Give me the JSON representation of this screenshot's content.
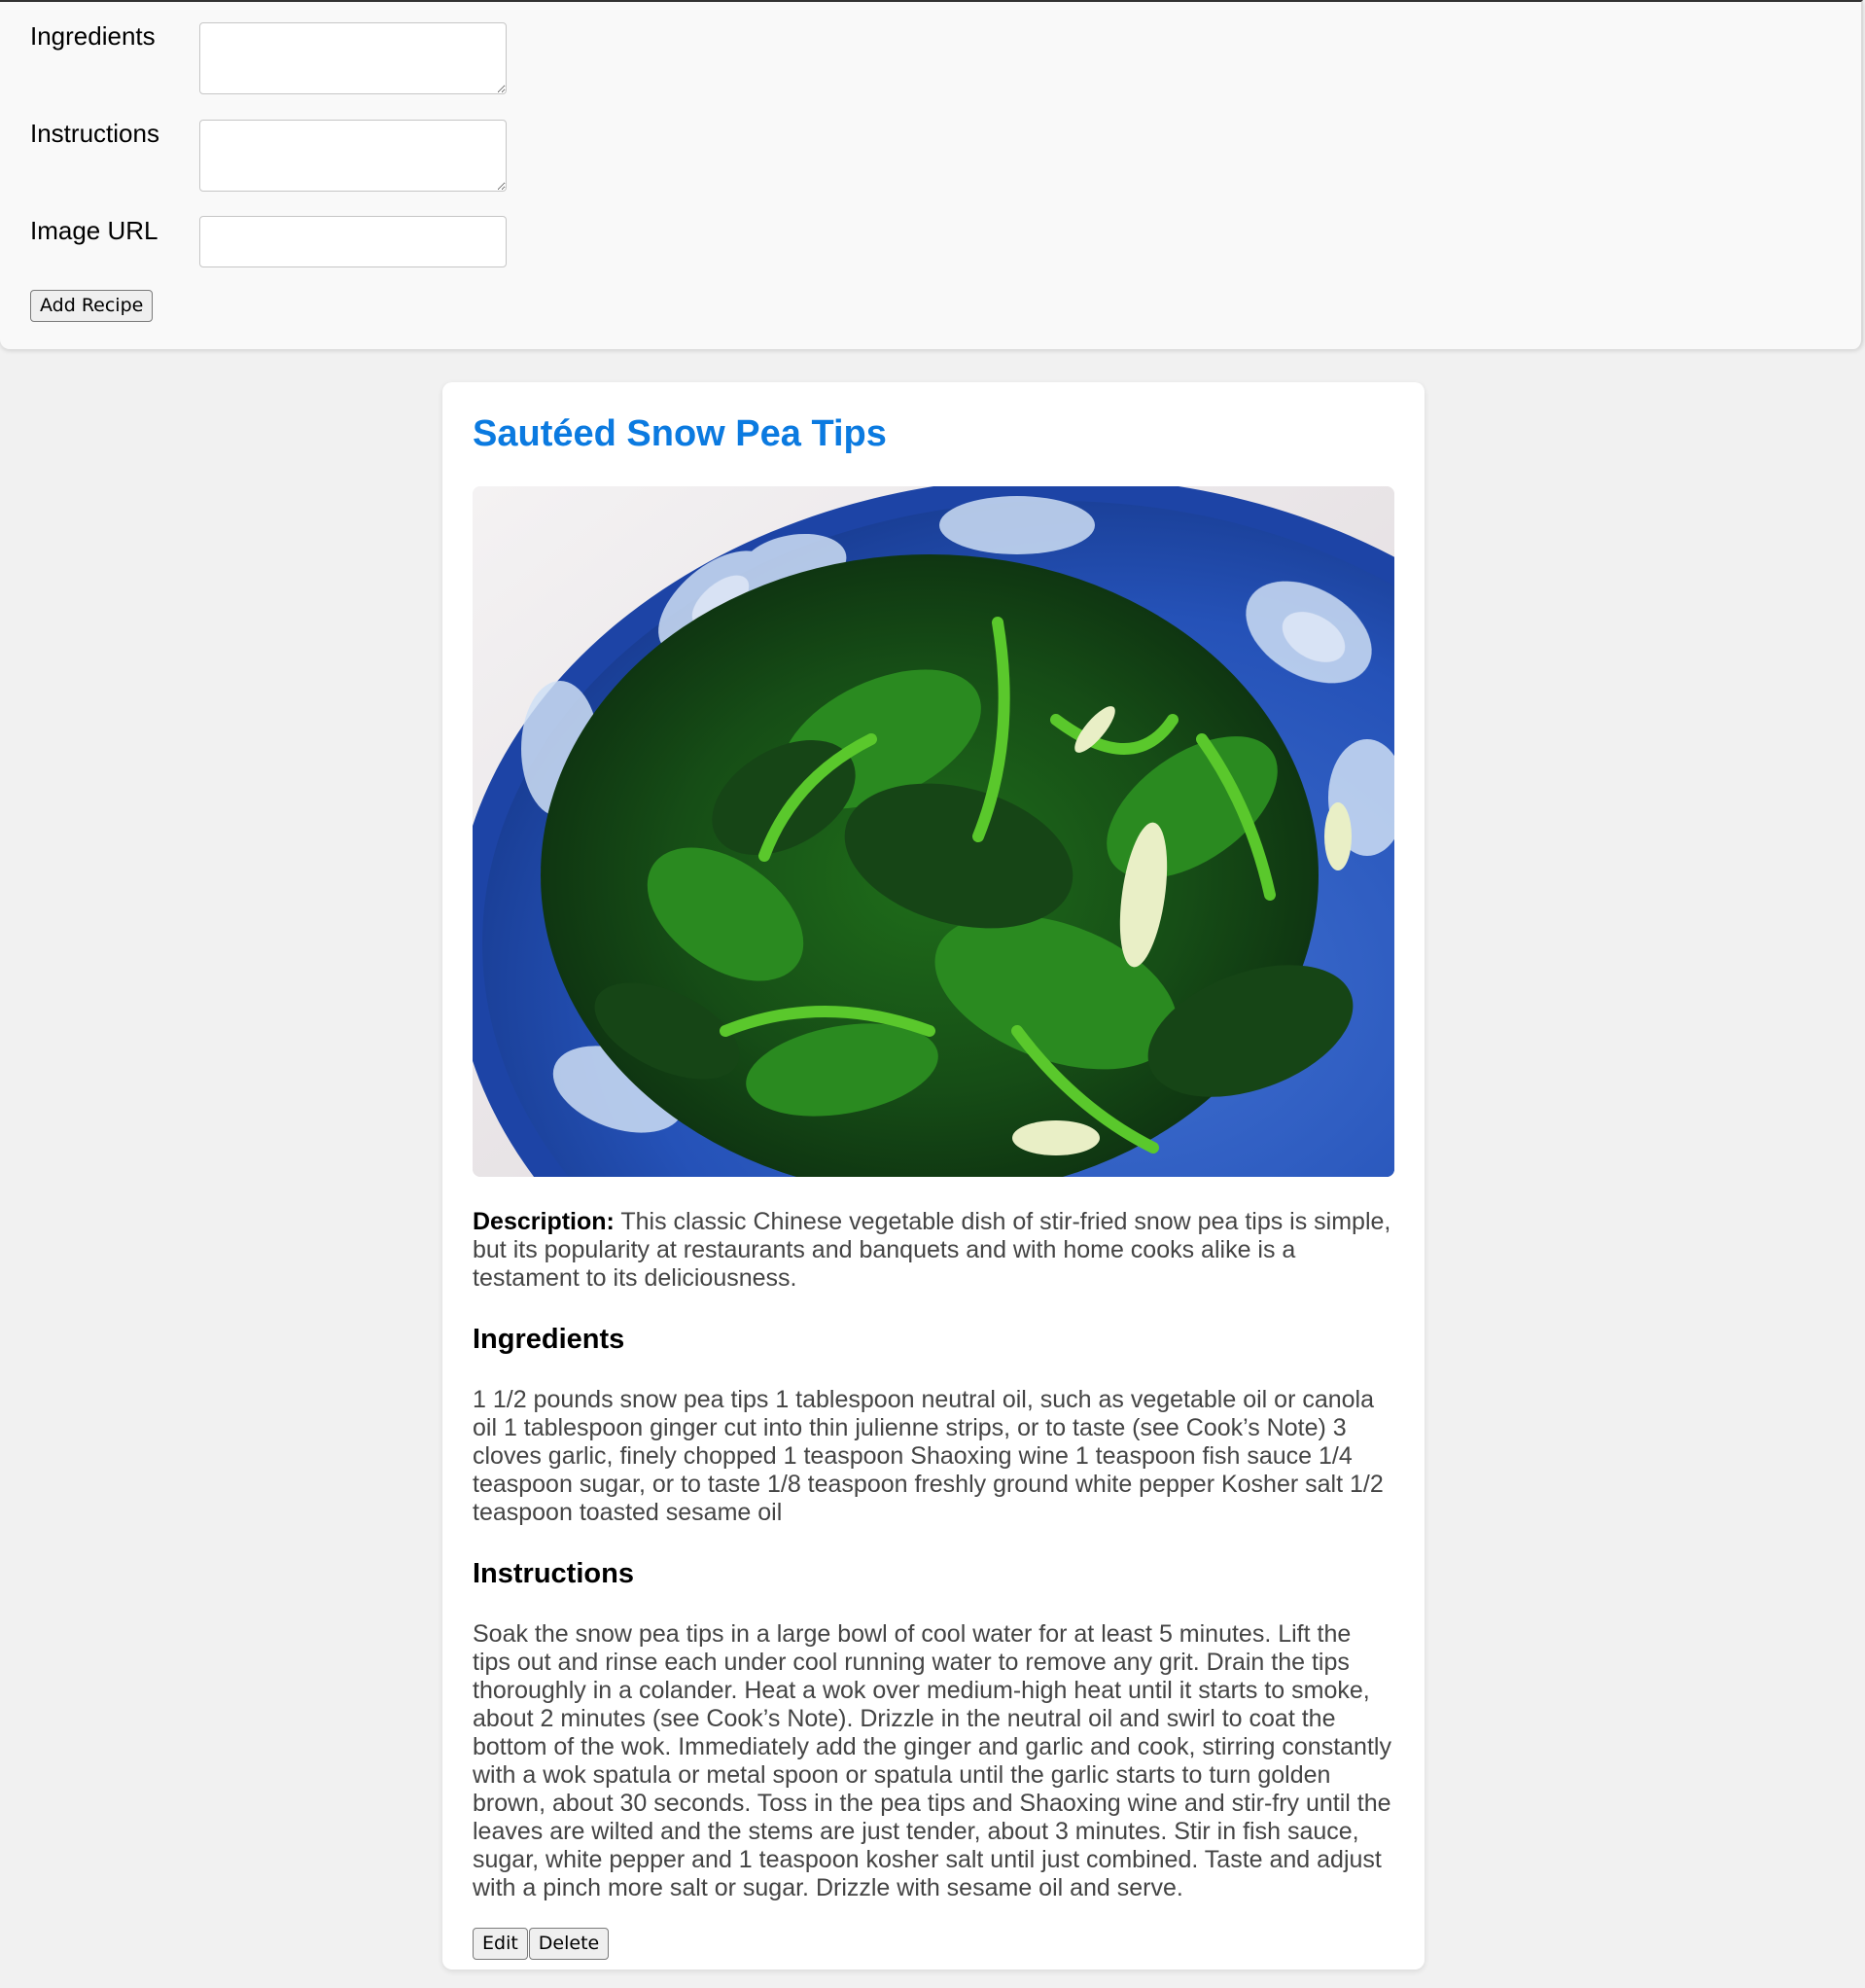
{
  "form": {
    "ingredients_label": "Ingredients",
    "ingredients_value": "",
    "instructions_label": "Instructions",
    "instructions_value": "",
    "image_url_label": "Image URL",
    "image_url_value": "",
    "submit_label": "Add Recipe"
  },
  "recipe": {
    "title": "Sautéed Snow Pea Tips",
    "image_alt": "Bowl of stir-fried snow pea tips",
    "description_label": "Description:",
    "description": "This classic Chinese vegetable dish of stir-fried snow pea tips is simple, but its popularity at restaurants and banquets and with home cooks alike is a testament to its deliciousness.",
    "ingredients_heading": "Ingredients",
    "ingredients": "1 1/2 pounds snow pea tips 1 tablespoon neutral oil, such as vegetable oil or canola oil 1 tablespoon ginger cut into thin julienne strips, or to taste (see Cook’s Note) 3 cloves garlic, finely chopped 1 teaspoon Shaoxing wine 1 teaspoon fish sauce 1/4 teaspoon sugar, or to taste 1/8 teaspoon freshly ground white pepper Kosher salt 1/2 teaspoon toasted sesame oil",
    "instructions_heading": "Instructions",
    "instructions": "Soak the snow pea tips in a large bowl of cool water for at least 5 minutes. Lift the tips out and rinse each under cool running water to remove any grit. Drain the tips thoroughly in a colander. Heat a wok over medium-high heat until it starts to smoke, about 2 minutes (see Cook’s Note). Drizzle in the neutral oil and swirl to coat the bottom of the wok. Immediately add the ginger and garlic and cook, stirring constantly with a wok spatula or metal spoon or spatula until the garlic starts to turn golden brown, about 30 seconds. Toss in the pea tips and Shaoxing wine and stir-fry until the leaves are wilted and the stems are just tender, about 3 minutes. Stir in fish sauce, sugar, white pepper and 1 teaspoon kosher salt until just combined. Taste and adjust with a pinch more salt or sugar. Drizzle with sesame oil and serve.",
    "edit_label": "Edit",
    "delete_label": "Delete"
  },
  "colors": {
    "title_blue": "#0b7ae0",
    "page_bg": "#f1f1f1",
    "card_bg": "#ffffff",
    "body_text": "#444444"
  }
}
